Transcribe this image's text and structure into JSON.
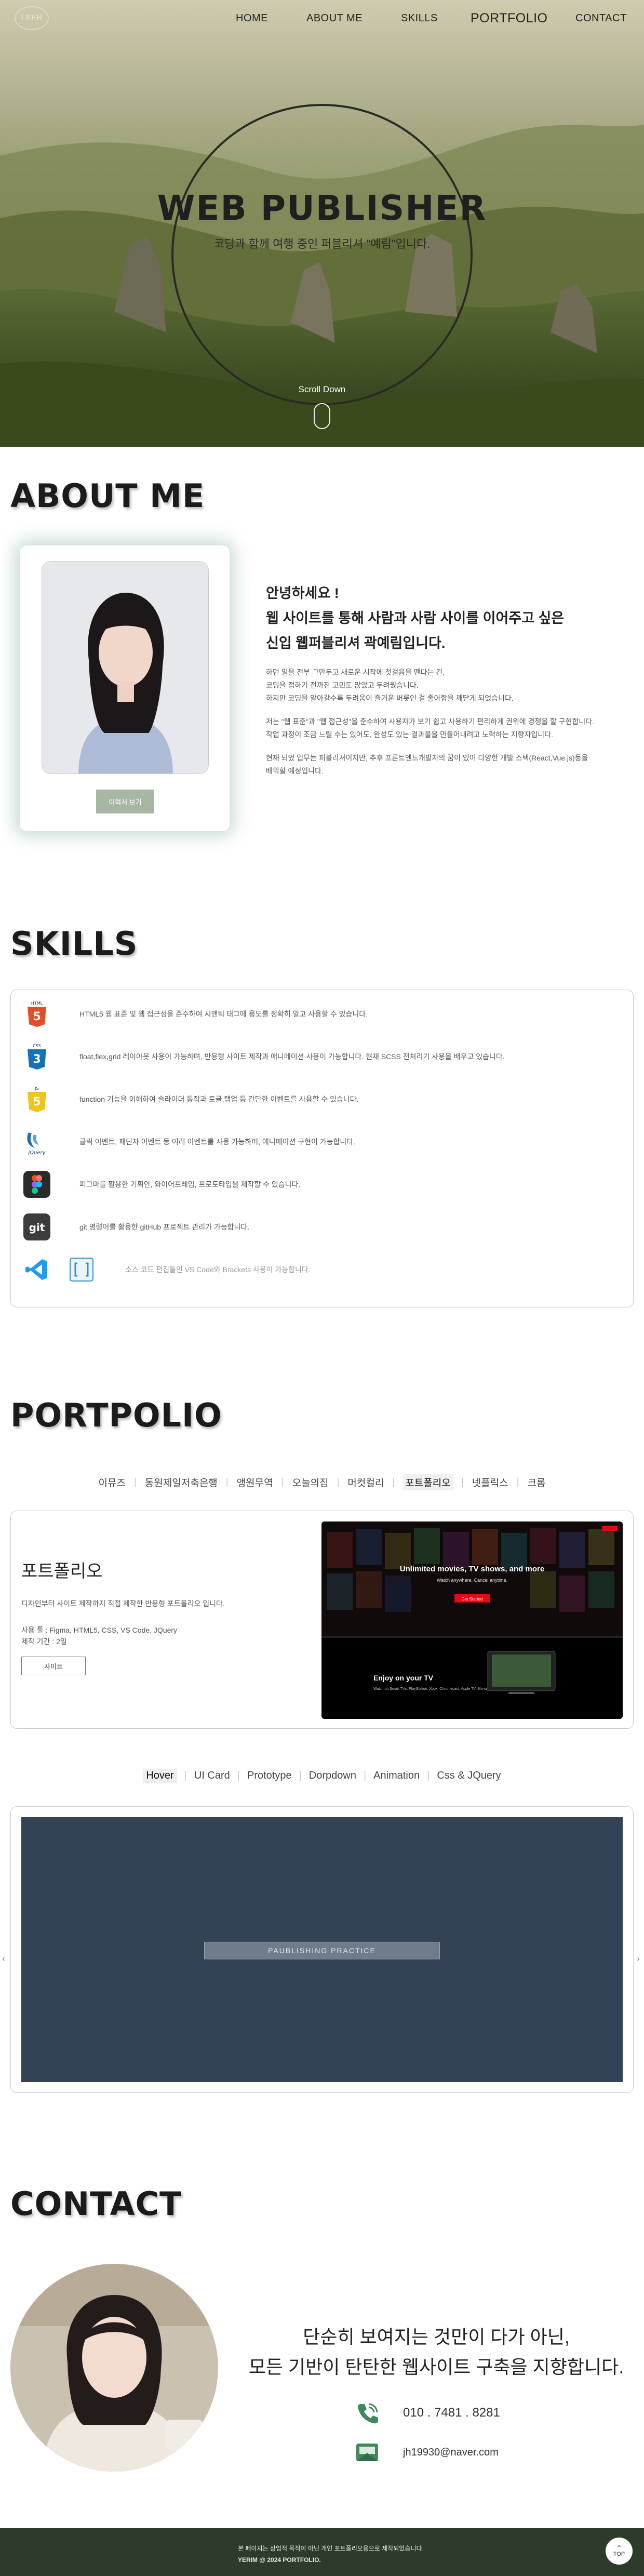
{
  "nav": {
    "logo": "LEEH",
    "items": [
      "HOME",
      "ABOUT ME",
      "SKILLS",
      "PORTFOLIO",
      "CONTACT"
    ]
  },
  "hero": {
    "title": "WEB PUBLISHER",
    "subtitle": "코딩과 함께 여행 중인 퍼블리셔 \"예림\"입니다.",
    "scroll_label": "Scroll Down"
  },
  "about": {
    "heading": "ABOUT ME",
    "more_button": "이력서 보기",
    "greeting": [
      "안녕하세요 !",
      "웹 사이트를 통해 사람과 사람 사이를 이어주고 싶은",
      "신입 웹퍼블리셔 곽예림입니다."
    ],
    "para1": [
      "하던 일을 전부 그만두고 새로운 시작에 첫걸음을 뗀다는 건,",
      "코딩을 접하기 전까진 고민도 많았고 두려웠습니다.",
      "하지만 코딩을 알아갈수록 두려움이 즐거운 버릇인 걸 좋아함을 깨닫게 되었습니다."
    ],
    "para2": [
      "저는 \"웹 표준\"과 \"웹 접근성\"을 준수하여 사용자가 보기 쉽고 사용하기 편리하게 권위에 경쟁을 할 구현합니다.",
      "작업 과정이 조금 느릴 수는 있어도, 완성도 있는 결과물을 만들어내려고 노력하는 지향자입니다."
    ],
    "para3": [
      "현재 되었 업무는 퍼블리셔이지만, 추후 프론트엔드개발자의 꿈이 있어 다양한 개발 스택(React,Vue.js)등을",
      "배워할 예정입니다."
    ]
  },
  "skills": {
    "heading": "SKILLS",
    "rows": [
      {
        "icon": "html5-icon",
        "badge": "HTML",
        "text": "HTML5 웹 표준 및 웹 접근성을 준수하여 시맨틱 태그에 용도를 정확히 알고 사용할 수 있습니다."
      },
      {
        "icon": "css3-icon",
        "badge": "CSS",
        "text": "float,flex,grid 레이아웃 사용이 가능하며, 반응형 사이트 제작과 애니메이션 사용이 가능합니다. 현재 SCSS 전처리기 사용을 배우고 있습니다."
      },
      {
        "icon": "js-icon",
        "badge": "JS",
        "text": "function 기능을 이해하여 슬라이더 동작과 토글,탭업 등 간단한 이벤트를 사용할 수 있습니다."
      },
      {
        "icon": "jquery-icon",
        "badge": "jQuery",
        "text": "클릭 이벤트, 패딘자 이벤트 등 여러 이벤트를 사용 가능하며, 애니메이션 구현이 가능합니다."
      },
      {
        "icon": "figma-icon",
        "badge": "",
        "text": "피그마를 활용한 기획안, 와이어프레임, 프로토타입을 제작할 수 있습니다."
      },
      {
        "icon": "git-icon",
        "badge": "git",
        "text": "git 명령어를 활용한 gitHub 프로젝트 관리가 가능합니다."
      },
      {
        "icon": "vscode-icon",
        "badge": "",
        "text": "소스 코드 편집툴인 VS Code와 Brackets 사용이 가능합니다."
      }
    ]
  },
  "portfolio": {
    "heading": "PORTPOLIO",
    "tabs": [
      "이뮤즈",
      "동원제일저축은행",
      "앵원무역",
      "오늘의집",
      "머컷컬리",
      "포트폴리오",
      "넷플릭스",
      "크롬"
    ],
    "active_tab": 5,
    "card": {
      "title": "포트폴리오",
      "desc": "디자인부터 사이트 제작까지 직접 제작한 반응형 포트폴리오 입니다.",
      "tools": "사용 툴 : Figma, HTML5, CSS, VS Code, JQuery",
      "period": "제작 기간 : 2일",
      "site_button": "사이트"
    },
    "preview": {
      "headline": "Unlimited movies, TV shows, and more",
      "sub1": "Watch anywhere. Cancel anytime.",
      "cta": "Get Started",
      "tv_title": "Enjoy on your TV",
      "tv_desc": "Watch on Smart TVs, PlayStation, Xbox, Chromecast, Apple TV, Blu-ray players, and more."
    },
    "tabs2": [
      "Hover",
      "UI Card",
      "Prototype",
      "Dorpdown",
      "Animation",
      "Css & JQuery"
    ],
    "active_tab2": 0,
    "hover_label": "PAUBLISHING PRACTICE"
  },
  "contact": {
    "heading": "CONTACT",
    "lead": [
      "단순히 보여지는 것만이 다가 아닌,",
      "모든 기반이 탄탄한 웹사이트 구축을 지향합니다."
    ],
    "phone": "010 . 7481 . 8281",
    "email": "jh19930@naver.com"
  },
  "footer": {
    "line1": "본 페이지는 상업적 목적이 아닌 개인 포트폴리오용으로 제작되었습니다.",
    "line2": "YERIM @ 2024 PORTFOLIO.",
    "top": "TOP"
  },
  "colors": {
    "footer_bg": "#2d3b2b",
    "button_sage": "#a8b6a4",
    "hover_panel": "#334255"
  }
}
